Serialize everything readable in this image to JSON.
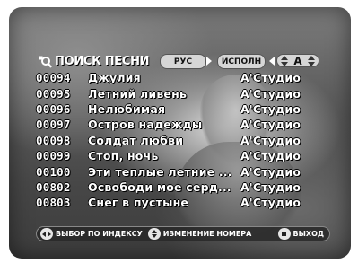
{
  "header": {
    "title": "ПОИСК ПЕСНИ",
    "language": "РУС",
    "mode": "ИСПОЛН",
    "letter": "A"
  },
  "songs": [
    {
      "num": "00094",
      "title": "Джулия",
      "artist": "A'Студио"
    },
    {
      "num": "00095",
      "title": "Летний ливень",
      "artist": "A'Студио"
    },
    {
      "num": "00096",
      "title": "Нелюбимая",
      "artist": "A'Студио"
    },
    {
      "num": "00097",
      "title": "Остров надежды",
      "artist": "A'Студио"
    },
    {
      "num": "00098",
      "title": "Солдат любви",
      "artist": "A'Студио"
    },
    {
      "num": "00099",
      "title": "Стоп, ночь",
      "artist": "A'Студио"
    },
    {
      "num": "00100",
      "title": "Эти теплые летние ...",
      "artist": "A'Студио"
    },
    {
      "num": "00802",
      "title": "Освободи мое серд...",
      "artist": "A'Студио"
    },
    {
      "num": "00803",
      "title": "Снег в пустыне",
      "artist": "A'Студио"
    }
  ],
  "footer": {
    "index_select": "ВЫБОР ПО ИНДЕКСУ",
    "change_number": "ИЗМЕНЕНИЕ НОМЕРА",
    "exit": "ВЫХОД"
  },
  "icons": [
    "search-icon",
    "arrow-right-icon",
    "arrow-left-icon",
    "up-down-icon",
    "left-right-icon",
    "stop-icon"
  ]
}
